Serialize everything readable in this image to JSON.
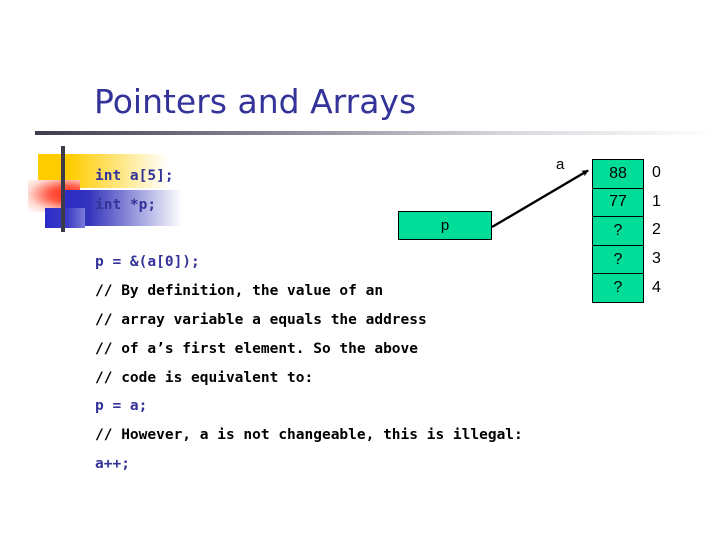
{
  "slide": {
    "title": "Pointers and Arrays",
    "title_color": "#333399",
    "background": "#ffffff"
  },
  "decoration": {
    "yellow_color": "#FFCC00",
    "red_color": "#FF2B1A",
    "blue_color": "#2B2BC9",
    "rule_color": "#3B3B4C"
  },
  "code": {
    "lines": [
      {
        "text": "int a[5];",
        "kind": "code"
      },
      {
        "text": "int *p;",
        "kind": "code"
      },
      {
        "text": "",
        "kind": "blank"
      },
      {
        "text": "p = &(a[0]);",
        "kind": "code"
      },
      {
        "text": "// By definition, the value of an",
        "kind": "comment"
      },
      {
        "text": "// array variable a equals the address",
        "kind": "comment"
      },
      {
        "text": "// of a’s first element. So the above",
        "kind": "comment"
      },
      {
        "text": "// code is equivalent to:",
        "kind": "comment"
      },
      {
        "text": "p = a;",
        "kind": "code"
      },
      {
        "text": "// However, a is not changeable, this is illegal:",
        "kind": "comment"
      },
      {
        "text": "a++;",
        "kind": "code"
      }
    ],
    "code_color": "#333399",
    "comment_color": "#000000"
  },
  "diagram": {
    "pointer_box": {
      "label": "p",
      "fill": "#00DD99"
    },
    "array": {
      "pointer_label": "a",
      "fill": "#00DD99",
      "cells": [
        {
          "value": "88",
          "index": "0"
        },
        {
          "value": "77",
          "index": "1"
        },
        {
          "value": "?",
          "index": "2"
        },
        {
          "value": "?",
          "index": "3"
        },
        {
          "value": "?",
          "index": "4"
        }
      ]
    }
  }
}
